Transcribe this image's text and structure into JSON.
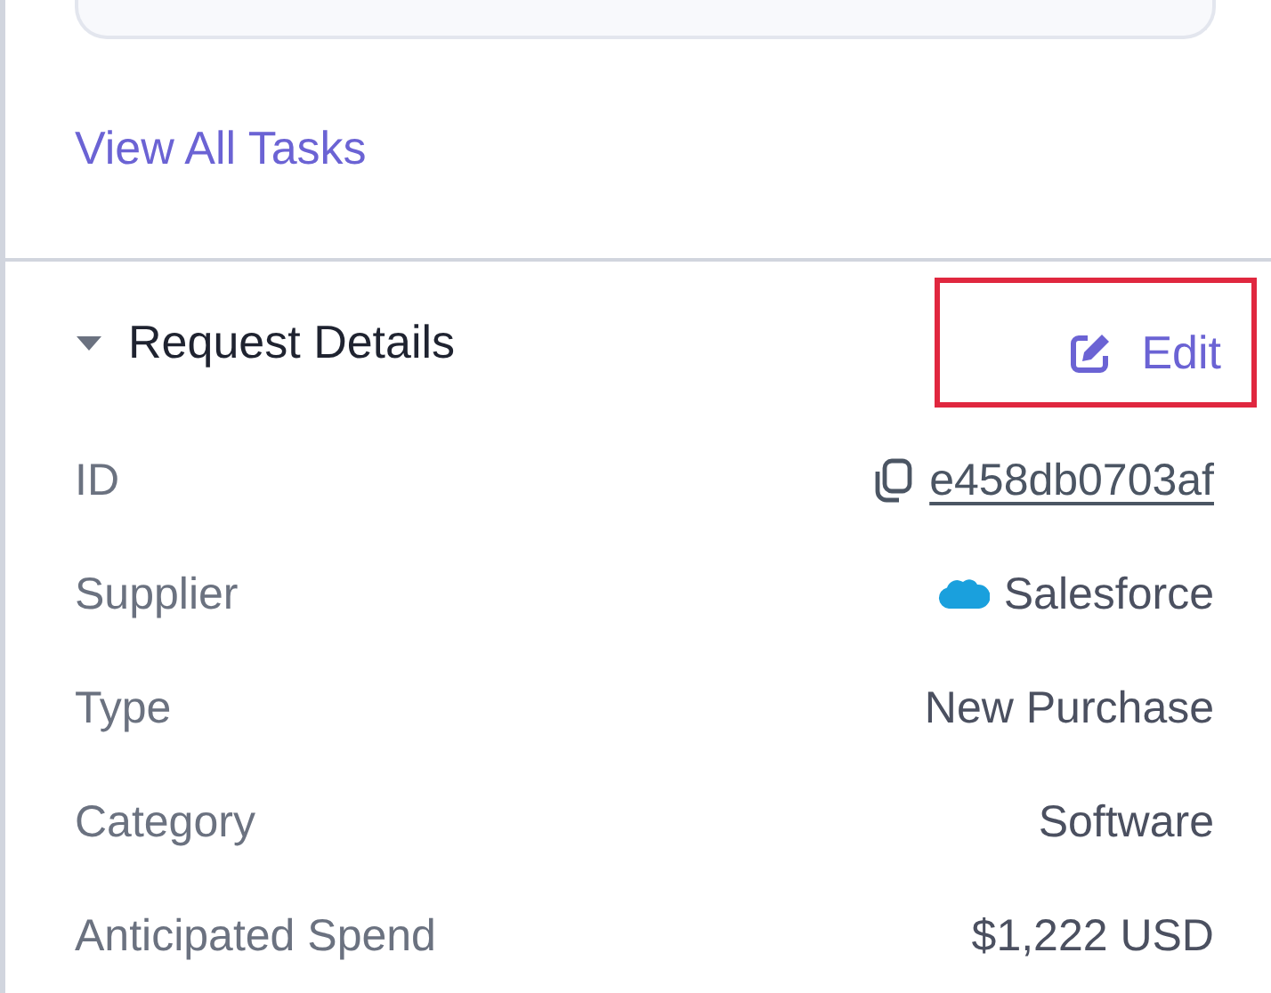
{
  "tasks": {
    "link": "View All Tasks"
  },
  "section": {
    "title": "Request Details",
    "expanded": true,
    "edit": {
      "label": "Edit",
      "highlighted": true
    },
    "rows": [
      {
        "label": "ID",
        "value": "e458db0703af",
        "kind": "link"
      },
      {
        "label": "Supplier",
        "value": "Salesforce",
        "kind": "supplier"
      },
      {
        "label": "Type",
        "value": "New Purchase",
        "kind": "text"
      },
      {
        "label": "Category",
        "value": "Software",
        "kind": "text"
      },
      {
        "label": "Anticipated Spend",
        "value": "$1,222 USD",
        "kind": "text"
      }
    ]
  }
}
